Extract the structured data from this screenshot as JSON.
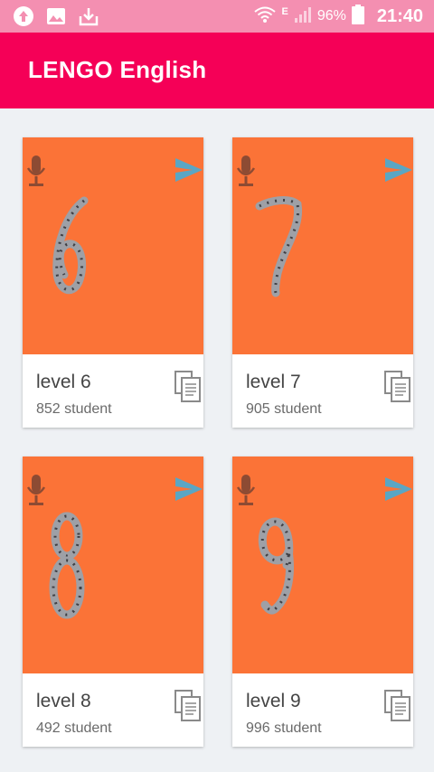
{
  "status_bar": {
    "icons": [
      "upload-icon",
      "image-icon",
      "download-icon",
      "wifi-icon",
      "signal-icon",
      "battery-icon"
    ],
    "network_type": "E",
    "battery_percent": "96%",
    "time": "21:40"
  },
  "app_bar": {
    "title": "LENGO English"
  },
  "cards": [
    {
      "level": "level 6",
      "students": "852 student",
      "digit": "6"
    },
    {
      "level": "level 7",
      "students": "905 student",
      "digit": "7"
    },
    {
      "level": "level 8",
      "students": "492 student",
      "digit": "8"
    },
    {
      "level": "level 9",
      "students": "996 student",
      "digit": "9"
    }
  ],
  "colors": {
    "status_bar": "#f48fb1",
    "app_bar": "#f50057",
    "card_image_background": "#fb7337",
    "mic_icon": "#8d4b33",
    "send_icon": "#5aa6c4",
    "background": "#eef1f4"
  }
}
